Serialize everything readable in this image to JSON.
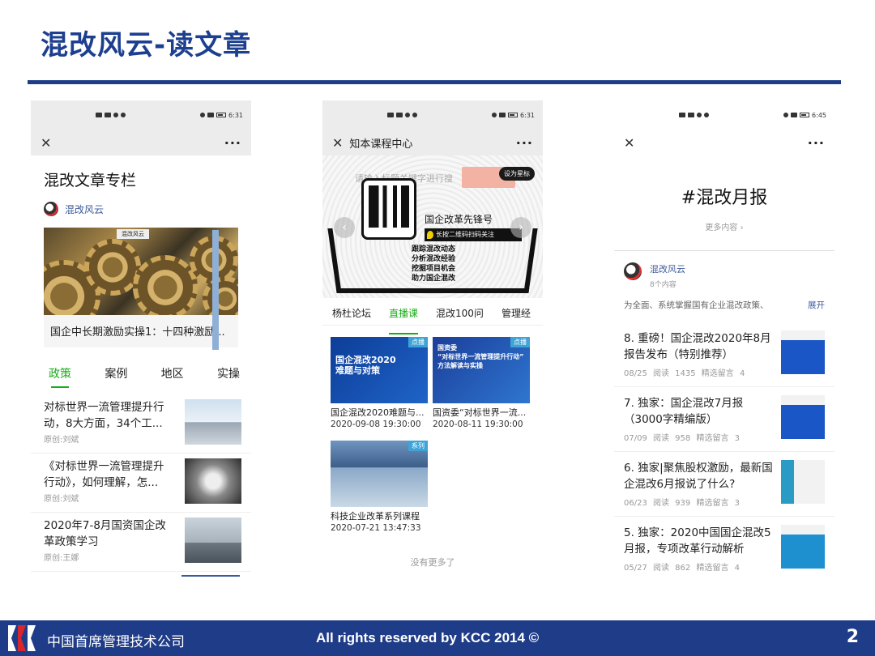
{
  "slide": {
    "title": "混改风云-读文章",
    "page_number": "2",
    "colors": {
      "brand_blue": "#1f3c88",
      "wechat_green": "#1aad19"
    }
  },
  "phone1": {
    "status_time": "6:31",
    "column_title": "混改文章专栏",
    "author": "混改风云",
    "banner_tag": "混改风云",
    "banner_caption": "国企中长期激励实操1：十四种激励...",
    "tabs": [
      "政策",
      "案例",
      "地区",
      "实操"
    ],
    "articles": [
      {
        "title": "对标世界一流管理提升行动，8大方面，34个工...",
        "author": "原创:刘斌"
      },
      {
        "title": "《对标世界一流管理提升行动》，如何理解，怎...",
        "author": "原创:刘斌"
      },
      {
        "title": "2020年7-8月国资国企改革政策学习",
        "author": "原创:王娜"
      }
    ]
  },
  "phone2": {
    "status_time": "6:31",
    "nav_title": "知本课程中心",
    "search_hint": "请输入标题关键字进行搜",
    "star_badge": "设为星标",
    "promo_name": "国企改革先锋号",
    "promo_bar": "长按二维码扫码关注",
    "promo_lines": [
      "跟踪混改动态",
      "分析混改经验",
      "挖掘项目机会",
      "助力国企混改"
    ],
    "tabs": [
      "杨杜论坛",
      "直播课",
      "混改100问",
      "管理经"
    ],
    "courses": [
      {
        "name": "国企混改2020难题与...",
        "time": "2020-09-08 19:30:00",
        "tag": "点播",
        "overlay": "国企混改2020\n难题与对策"
      },
      {
        "name": "国资委“对标世界一流...",
        "time": "2020-08-11 19:30:00",
        "tag": "点播",
        "overlay": "国资委\n“对标世界一流管理提升行动”\n方法解读与实操"
      },
      {
        "name": "科技企业改革系列课程",
        "time": "2020-07-21 13:47:33",
        "tag": "系列",
        "overlay": ""
      }
    ],
    "no_more": "没有更多了"
  },
  "phone3": {
    "status_time": "6:45",
    "topic": "#混改月报",
    "more": "更多内容 ›",
    "author": "混改风云",
    "count": "8个内容",
    "desc": "为全面、系统掌握国有企业混改政策、",
    "expand": "展开",
    "reports": [
      {
        "title": "8. 重磅！国企混改2020年8月报告发布（特别推荐）",
        "meta": "08/25 阅读 1435 精选留言 4"
      },
      {
        "title": "7. 独家：国企混改7月报（3000字精编版）",
        "meta": "07/09 阅读 958 精选留言 3"
      },
      {
        "title": "6. 独家|聚焦股权激励，最新国企混改6月报说了什么?",
        "meta": "06/23 阅读 939 精选留言 3"
      },
      {
        "title": "5. 独家：2020中国国企混改5月报，专项改革行动解析",
        "meta": "05/27 阅读 862 精选留言 4"
      }
    ]
  },
  "footer": {
    "company": "中国首席管理技术公司",
    "rights": "All rights reserved by KCC 2014 ©"
  }
}
